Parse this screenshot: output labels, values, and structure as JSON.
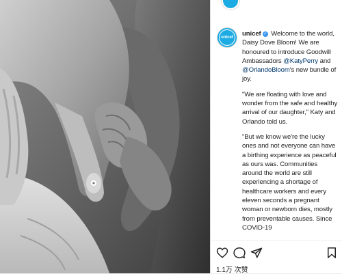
{
  "post": {
    "username": "unicef",
    "avatar_label": "unicef",
    "brand_color": "#1cabe2",
    "mention_color": "#00376b",
    "caption": {
      "p1": "Welcome to the world, Daisy Dove Bloom! We are honoured to introduce Goodwill Ambassadors",
      "p1_mention1": "@KatyPerry",
      "p1_and": "and",
      "p1_mention2": "@OrlandoBloom",
      "p1_end": "'s new bundle of joy.",
      "p2": "\"We are floating with love and wonder from the safe and healthy arrival of our daughter,\" Katy and Orlando told us.",
      "p3": "\"But we know we're the lucky ones and not everyone can have a birthing experience as peaceful as ours was. Communities around the world are still experiencing a shortage of healthcare workers and every eleven seconds a pregnant woman or newborn dies, mostly from preventable causes. Since COVID-19"
    },
    "likes": "1.1万 次赞"
  },
  "icons": [
    "heart-icon",
    "comment-icon",
    "share-icon",
    "bookmark-icon"
  ]
}
